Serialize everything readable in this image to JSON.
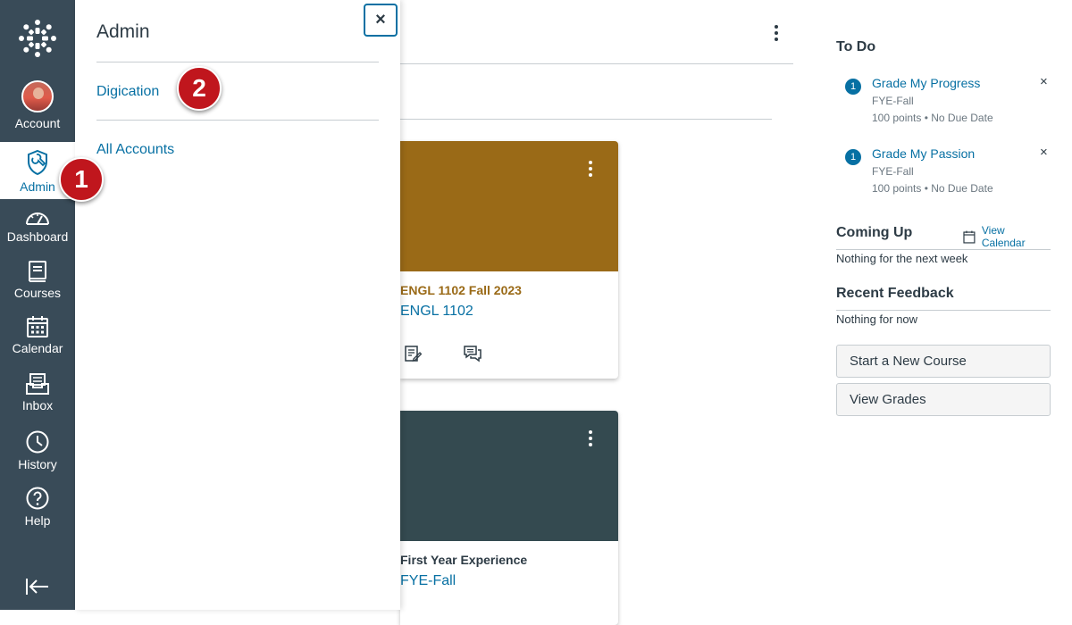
{
  "global_nav": {
    "items": [
      {
        "label": "Account",
        "icon": "avatar"
      },
      {
        "label": "Admin",
        "icon": "admin-shield-icon",
        "active": true
      },
      {
        "label": "Dashboard",
        "icon": "dashboard-gauge-icon"
      },
      {
        "label": "Courses",
        "icon": "book-icon"
      },
      {
        "label": "Calendar",
        "icon": "calendar-icon"
      },
      {
        "label": "Inbox",
        "icon": "inbox-icon"
      },
      {
        "label": "History",
        "icon": "clock-icon"
      },
      {
        "label": "Help",
        "icon": "question-icon"
      }
    ],
    "collapse_icon": "collapse-arrow-icon",
    "bg_color": "#394b58",
    "active_color": "#0770a3"
  },
  "callouts": {
    "step1": "1",
    "step2": "2",
    "color": "#c0161d"
  },
  "admin_tray": {
    "title": "Admin",
    "close_label": "×",
    "links": [
      "Digication",
      "All Accounts"
    ]
  },
  "cards": [
    {
      "term": "ENGL 1102 Fall 2023",
      "code": "ENGL 1102",
      "hero_color": "#9a6a17",
      "term_color": "#9a6a17"
    },
    {
      "term": "First Year Experience",
      "code": "FYE-Fall",
      "hero_color": "#344a50",
      "term_color": "#2d3b45"
    }
  ],
  "sidebar": {
    "todo_title": "To Do",
    "todos": [
      {
        "count": "1",
        "title": "Grade My Progress",
        "course": "FYE-Fall",
        "meta": "100 points • No Due Date",
        "close": "×"
      },
      {
        "count": "1",
        "title": "Grade My Passion",
        "course": "FYE-Fall",
        "meta": "100 points • No Due Date",
        "close": "×"
      }
    ],
    "coming_up_title": "Coming Up",
    "view_calendar": "View Calendar",
    "coming_up_text": "Nothing for the next week",
    "feedback_title": "Recent Feedback",
    "feedback_text": "Nothing for now",
    "buttons": [
      "Start a New Course",
      "View Grades"
    ]
  }
}
